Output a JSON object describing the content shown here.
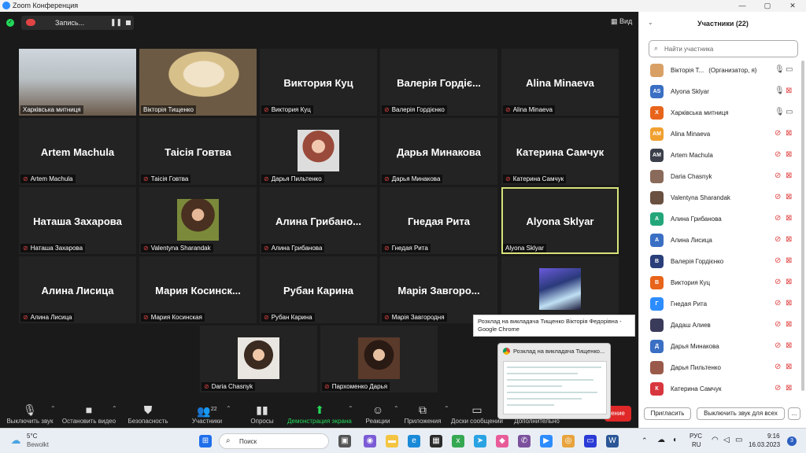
{
  "window": {
    "title": "Zoom Конференция"
  },
  "meeting_bar": {
    "record_label": "Запись...",
    "view_label": "Вид"
  },
  "tiles": [
    {
      "display": "",
      "label": "Харківська митниця",
      "muted": false
    },
    {
      "display": "",
      "label": "Вікторія Тищенко",
      "muted": false
    },
    {
      "display": "Виктория  Куц",
      "label": "Виктория  Куц",
      "muted": true
    },
    {
      "display": "Валерія Гордіє...",
      "label": "Валерія Гордієнко",
      "muted": true
    },
    {
      "display": "Alina Minaeva",
      "label": "Alina Minaeva",
      "muted": true
    },
    {
      "display": "Artem Machula",
      "label": "Artem Machula",
      "muted": true
    },
    {
      "display": "Таісія Говтва",
      "label": "Таісія Говтва",
      "muted": true
    },
    {
      "display": "",
      "label": "Дарья Пильтенко",
      "muted": true
    },
    {
      "display": "Дарья Минакова",
      "label": "Дарья Минакова",
      "muted": true
    },
    {
      "display": "Катерина Самчук",
      "label": "Катерина Самчук",
      "muted": true
    },
    {
      "display": "Наташа Захарова",
      "label": "Наташа Захарова",
      "muted": true
    },
    {
      "display": "",
      "label": "Valentyna Sharandak",
      "muted": true
    },
    {
      "display": "Алина  Грибано...",
      "label": "Алина Грибанова",
      "muted": true
    },
    {
      "display": "Гнедая Рита",
      "label": "Гнедая Рита",
      "muted": true
    },
    {
      "display": "Alyona Sklyar",
      "label": "Alyona Sklyar",
      "muted": false
    },
    {
      "display": "Алина Лисица",
      "label": "Алина Лисица",
      "muted": true
    },
    {
      "display": "Мария  Косинск...",
      "label": "Мария Косинская",
      "muted": true
    },
    {
      "display": "Рубан Карина",
      "label": "Рубан Карина",
      "muted": true
    },
    {
      "display": "Марія  Завгоро...",
      "label": "Марія Завгородня",
      "muted": true
    },
    {
      "display": "",
      "label": "",
      "muted": false
    },
    {
      "display": "",
      "label": "Daria Chasnyk",
      "muted": true
    },
    {
      "display": "",
      "label": "Пархоменко Дарья",
      "muted": true
    }
  ],
  "toolbar": {
    "audio": "Выключить звук",
    "video": "Остановить видео",
    "security": "Безопасность",
    "participants": "Участники",
    "participants_count": "22",
    "polls": "Опросы",
    "share": "Демонстрация экрана",
    "reactions": "Реакции",
    "apps": "Приложения",
    "whiteboards": "Доски сообщений",
    "more": "Дополнительно",
    "end_fragment": "ение"
  },
  "tooltip": {
    "text": "Розклад на викладача Тищенко Вікторія Федорівна - Google Chrome"
  },
  "preview": {
    "title": "Розклад на викладача Тищенко..."
  },
  "panel": {
    "title": "Участники (22)",
    "search_placeholder": "Найти участника",
    "invite": "Пригласить",
    "mute_all": "Выключить звук для всех",
    "more": "...",
    "participants": [
      {
        "initials": "",
        "name": "Вікторія Т...",
        "role": "(Организатор, я)",
        "color": "#d9a066",
        "mic": "on",
        "cam": "on"
      },
      {
        "initials": "AS",
        "name": "Alyona Sklyar",
        "role": "",
        "color": "#3a6fc4",
        "mic": "on",
        "cam": "off"
      },
      {
        "initials": "Х",
        "name": "Харківська митниця",
        "role": "",
        "color": "#e8641b",
        "mic": "on",
        "cam": "on"
      },
      {
        "initials": "AM",
        "name": "Alina Minaeva",
        "role": "",
        "color": "#f0a030",
        "mic": "off",
        "cam": "off"
      },
      {
        "initials": "AM",
        "name": "Artem Machula",
        "role": "",
        "color": "#3a3f4a",
        "mic": "off",
        "cam": "off"
      },
      {
        "initials": "",
        "name": "Daria Chasnyk",
        "role": "",
        "color": "#8a6a5a",
        "mic": "off",
        "cam": "off"
      },
      {
        "initials": "",
        "name": "Valentyna Sharandak",
        "role": "",
        "color": "#6a5040",
        "mic": "off",
        "cam": "off"
      },
      {
        "initials": "А",
        "name": "Алина Грибанова",
        "role": "",
        "color": "#22a67a",
        "mic": "off",
        "cam": "off"
      },
      {
        "initials": "А",
        "name": "Алина Лисица",
        "role": "",
        "color": "#3a6fc4",
        "mic": "off",
        "cam": "off"
      },
      {
        "initials": "В",
        "name": "Валерія Гордієнко",
        "role": "",
        "color": "#2a3f7a",
        "mic": "off",
        "cam": "off"
      },
      {
        "initials": "В",
        "name": "Виктория  Куц",
        "role": "",
        "color": "#e8641b",
        "mic": "off",
        "cam": "off"
      },
      {
        "initials": "Г",
        "name": "Гнедая Рита",
        "role": "",
        "color": "#2d8cff",
        "mic": "off",
        "cam": "off"
      },
      {
        "initials": "",
        "name": "Дадаш Алиев",
        "role": "",
        "color": "#3a3a5a",
        "mic": "off",
        "cam": "off"
      },
      {
        "initials": "Д",
        "name": "Дарья Минакова",
        "role": "",
        "color": "#3a6fc4",
        "mic": "off",
        "cam": "off"
      },
      {
        "initials": "",
        "name": "Дарья Пильтенко",
        "role": "",
        "color": "#9a5a4a",
        "mic": "off",
        "cam": "off"
      },
      {
        "initials": "К",
        "name": "Катерина Самчук",
        "role": "",
        "color": "#d8363e",
        "mic": "off",
        "cam": "off"
      }
    ]
  },
  "taskbar": {
    "weather_temp": "5°C",
    "weather_desc": "Bewolkt",
    "search_placeholder": "Поиск",
    "lang1": "РУС",
    "lang2": "RU",
    "time": "9:16",
    "date": "16.03.2023",
    "notif": "3"
  }
}
